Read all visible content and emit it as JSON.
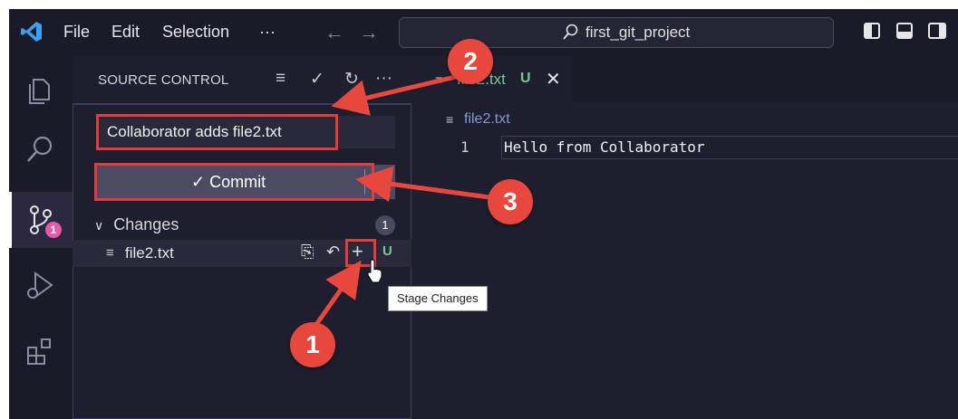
{
  "titlebar": {
    "menus": [
      "File",
      "Edit",
      "Selection",
      "···"
    ],
    "search_text": "first_git_project"
  },
  "sidebar": {
    "title": "SOURCE CONTROL",
    "commit_message": "Collaborator adds file2.txt",
    "commit_label": "✓ Commit",
    "changes_label": "Changes",
    "changes_count": "1",
    "file_name": "file2.txt",
    "file_status": "U",
    "scm_badge": "1"
  },
  "editor": {
    "tab_name": "file2.txt",
    "tab_status": "U",
    "breadcrumb": "file2.txt",
    "line_number": "1",
    "code": "Hello from Collaborator"
  },
  "tooltip": "Stage Changes",
  "callouts": [
    "1",
    "2",
    "3"
  ],
  "colors": {
    "callout": "#e8473d",
    "highlight": "#e03c3c",
    "untracked": "#73c991",
    "badge": "#e05ca8"
  }
}
